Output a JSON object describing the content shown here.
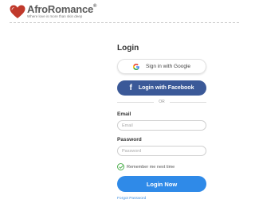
{
  "header": {
    "logo_name": "AfroRomance",
    "logo_reg": "®",
    "logo_tagline": "Where love is more than skin deep"
  },
  "login": {
    "title": "Login",
    "google_label": "Sign in with Google",
    "facebook_icon": "f",
    "facebook_label": "Login with Facebook",
    "or_text": "OR",
    "email_label": "Email",
    "email_placeholder": "Email",
    "email_value": "",
    "password_label": "Password",
    "password_placeholder": "Password",
    "password_value": "",
    "remember_label": "Remember me next time",
    "remember_checked": true,
    "submit_label": "Login Now",
    "forgot_label": "Forgot Password"
  },
  "colors": {
    "facebook": "#3b5998",
    "primary": "#2f8ae8",
    "check_green": "#4cae4c",
    "logo_heart": "#c0392b"
  },
  "icons": [
    "heart-logo-icon",
    "google-icon",
    "facebook-icon",
    "check-circle-icon"
  ]
}
